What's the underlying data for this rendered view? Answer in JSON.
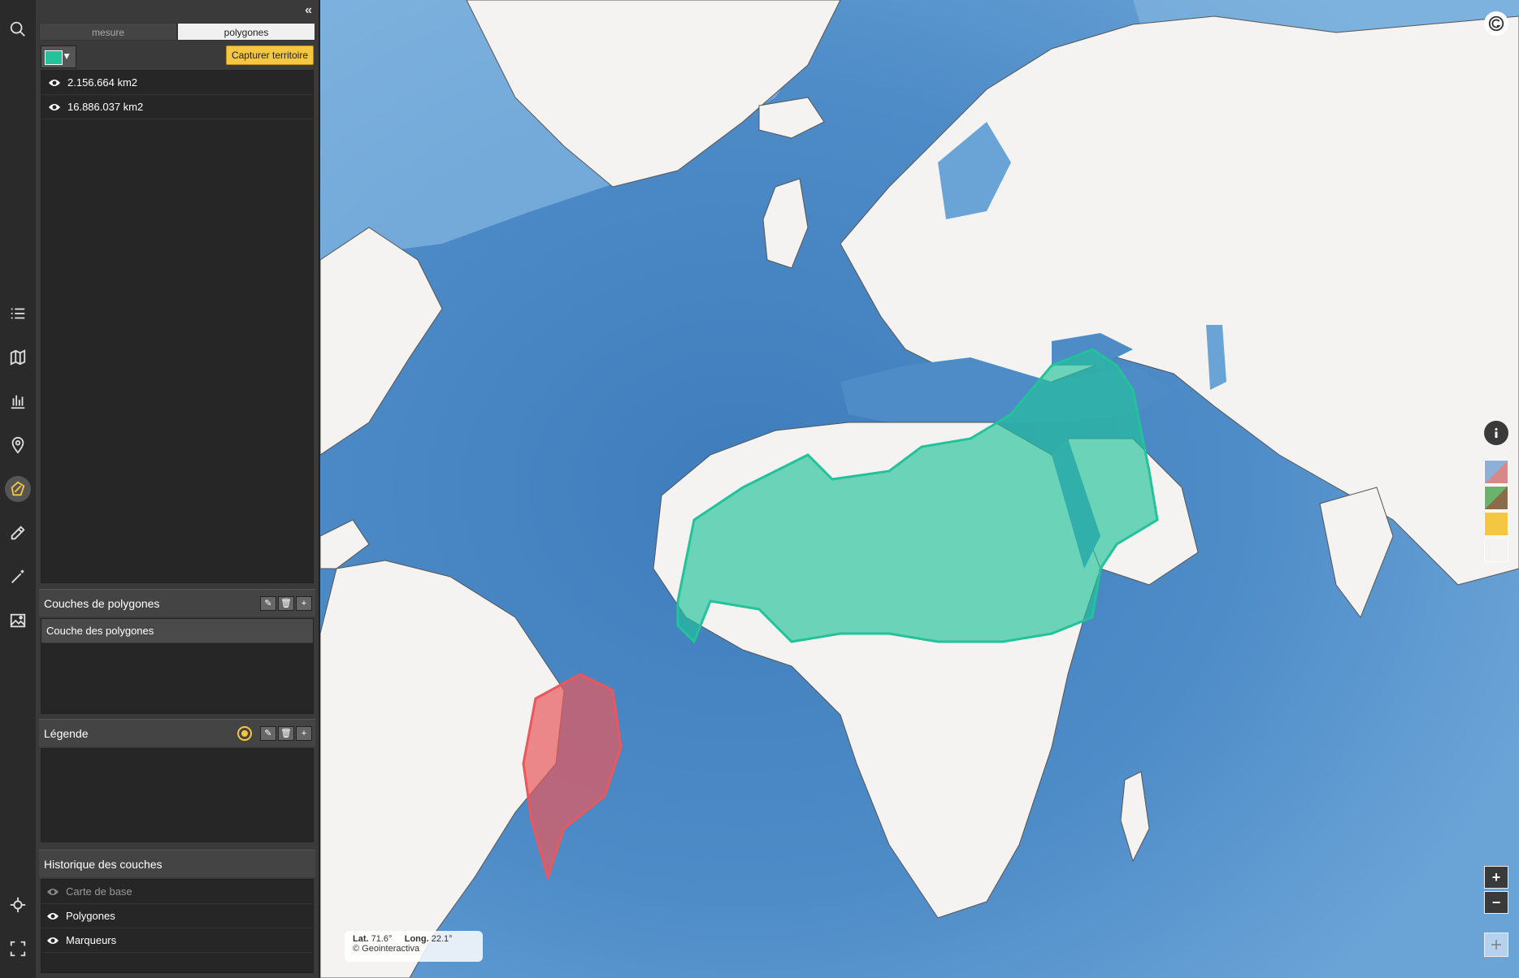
{
  "panel": {
    "collapse_icon": "double-chevron-left",
    "tabs": [
      {
        "label": "mesure",
        "active": false
      },
      {
        "label": "polygones",
        "active": true
      }
    ],
    "color": "#22c29a",
    "capture_label": "Capturer territoire",
    "polygons": [
      {
        "area": "2.156.664 km2"
      },
      {
        "area": "16.886.037 km2"
      }
    ],
    "layers_section": {
      "title": "Couches de polygones",
      "items": [
        "Couche des polygones"
      ]
    },
    "legend_section": {
      "title": "Légende"
    },
    "history_section": {
      "title": "Historique des couches",
      "items": [
        {
          "label": "Carte de base",
          "visible": false
        },
        {
          "label": "Polygones",
          "visible": true
        },
        {
          "label": "Marqueurs",
          "visible": true
        }
      ]
    }
  },
  "map": {
    "coords": {
      "lat_label": "Lat.",
      "lat_value": "71.6°",
      "long_label": "Long.",
      "long_value": "22.1°"
    },
    "attribution": "© Geointeractiva",
    "zoom_in": "+",
    "zoom_out": "−",
    "polygon_colors": {
      "green": "#22c29a",
      "red": "#e8585c"
    }
  }
}
